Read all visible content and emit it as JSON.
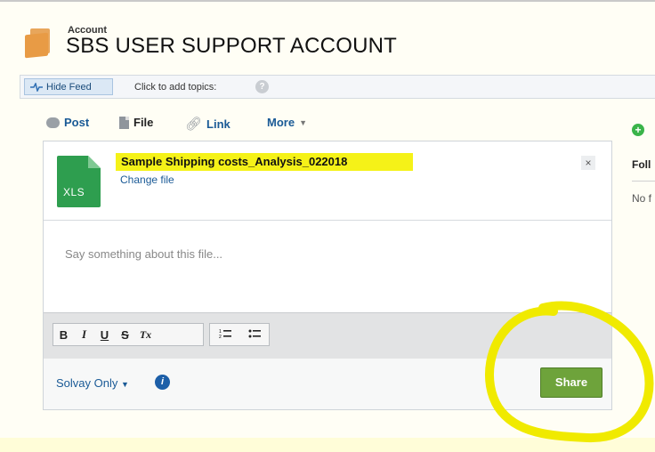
{
  "header": {
    "object_type": "Account",
    "title": "SBS USER SUPPORT ACCOUNT"
  },
  "topic_bar": {
    "hide_feed_label": "Hide Feed",
    "add_topics_label": "Click to add topics:"
  },
  "publisher": {
    "tabs": [
      {
        "label": "Post",
        "icon": "chat-bubble-icon"
      },
      {
        "label": "File",
        "icon": "document-icon"
      },
      {
        "label": "Link",
        "icon": "link-icon"
      },
      {
        "label": "More",
        "icon": "chevron-down-icon"
      }
    ],
    "active_tab": "File"
  },
  "file_attachment": {
    "file_type_label": "XLS",
    "filename": "Sample Shipping costs_Analysis_022018",
    "change_file_label": "Change file",
    "close_glyph": "×"
  },
  "composer": {
    "placeholder": "Say something about this file..."
  },
  "format_toolbar": {
    "group1": [
      "B",
      "I",
      "U",
      "S",
      "Tx"
    ],
    "group2": [
      "numbered-list",
      "bulleted-list"
    ]
  },
  "footer": {
    "visibility_label": "Solvay Only",
    "share_label": "Share"
  },
  "right_panel": {
    "follow_text": "Foll",
    "no_text": "No f"
  },
  "colors": {
    "share_green": "#6ea33b",
    "link_blue": "#1a5a96",
    "highlight_yellow": "#f5f218",
    "annotation_yellow": "#f0ea00",
    "xls_green": "#2e9e4f"
  }
}
